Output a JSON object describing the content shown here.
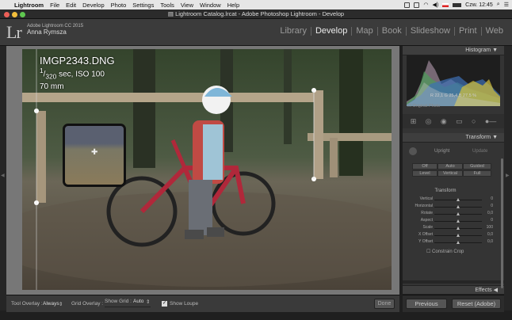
{
  "menubar": {
    "app": "Lightroom",
    "items": [
      "File",
      "Edit",
      "Develop",
      "Photo",
      "Settings",
      "Tools",
      "View",
      "Window",
      "Help"
    ],
    "clock": "Czw. 12:45"
  },
  "window": {
    "title": "Lightroom Catalog.lrcat - Adobe Photoshop Lightroom - Develop"
  },
  "identity": {
    "product": "Adobe Lightroom CC 2015",
    "user": "Anna Rymsza",
    "logo": "Lr"
  },
  "modules": [
    {
      "label": "Library",
      "active": false
    },
    {
      "label": "Develop",
      "active": true
    },
    {
      "label": "Map",
      "active": false
    },
    {
      "label": "Book",
      "active": false
    },
    {
      "label": "Slideshow",
      "active": false
    },
    {
      "label": "Print",
      "active": false
    },
    {
      "label": "Web",
      "active": false
    }
  ],
  "photo": {
    "filename": "IMGP2343.DNG",
    "shutter_num": "1",
    "shutter_den": "320",
    "shutter_unit": "sec, ISO 100",
    "focal": "70 mm"
  },
  "toolbar": {
    "tool_overlay_label": "Tool Overlay :",
    "tool_overlay_value": "Always",
    "grid_overlay_label": "Grid Overlay :",
    "show_grid_label": "Show Grid :",
    "show_grid_value": "Auto",
    "show_loupe_label": "Show Loupe",
    "done_label": "Done"
  },
  "histogram": {
    "title": "Histogram",
    "stats": "R 22,1  G 25,4  B 27,5 %",
    "original_photo": "Original Photo"
  },
  "transform": {
    "title": "Transform",
    "upright_label": "Upright",
    "update_label": "Update",
    "buttons": [
      "Off",
      "Auto",
      "Guided",
      "Level",
      "Vertical",
      "Full"
    ],
    "section_title": "Transform",
    "sliders": [
      {
        "label": "Vertical",
        "value": "0",
        "pos": 0.5
      },
      {
        "label": "Horizontal",
        "value": "0",
        "pos": 0.5
      },
      {
        "label": "Rotate",
        "value": "0,0",
        "pos": 0.5
      },
      {
        "label": "Aspect",
        "value": "0",
        "pos": 0.5
      },
      {
        "label": "Scale",
        "value": "100",
        "pos": 0.5
      },
      {
        "label": "X Offset",
        "value": "0,0",
        "pos": 0.5
      },
      {
        "label": "Y Offset",
        "value": "0,0",
        "pos": 0.5
      }
    ],
    "constrain_crop": "Constrain Crop"
  },
  "effects": {
    "title": "Effects"
  },
  "bottom_buttons": {
    "previous": "Previous",
    "reset": "Reset (Adobe)"
  },
  "colors": {
    "accent": "#ececec",
    "panel": "#343434",
    "background": "#1f1f1f"
  }
}
